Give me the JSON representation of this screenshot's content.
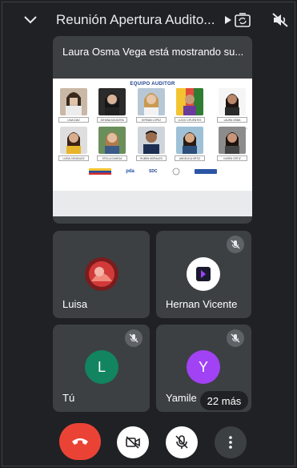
{
  "header": {
    "title": "Reunión Apertura Audito...",
    "icons": [
      "chevron-down-icon",
      "play-arrow-icon",
      "switch-camera-icon",
      "speaker-off-icon"
    ]
  },
  "presentation": {
    "label": "Laura Osma Vega está mostrando su...",
    "slide_title": "EQUIPO AUDITOR",
    "members_row1": [
      "LINA DIAZ",
      "JOHANA AGUILERA",
      "MYRIAM LOPEZ",
      "LUCIO CIFUENTES",
      "LAURA OSMA"
    ],
    "members_row2": [
      "LUISA GONZALEZ",
      "STELLA GARCIA",
      "RUBEN MORALES",
      "ANGELICA ORTIZ",
      "KAREN ORTIZ"
    ],
    "logos": [
      "pda",
      "SDC"
    ]
  },
  "participants": [
    {
      "name": "Luisa",
      "avatar_type": "photo",
      "muted": false
    },
    {
      "name": "Hernan Vicente",
      "avatar_type": "logo",
      "muted": true
    },
    {
      "name": "Tú",
      "initial": "L",
      "color": "#12845f",
      "muted": true
    },
    {
      "name": "Yamile",
      "initial": "Y",
      "color": "#a142f4",
      "muted": true
    }
  ],
  "more_badge": "22 más",
  "controls": [
    "end-call",
    "camera-off",
    "mic-off",
    "more-options"
  ],
  "colors": {
    "background": "#202124",
    "tile": "#3c4043",
    "end_call": "#ea4335"
  }
}
